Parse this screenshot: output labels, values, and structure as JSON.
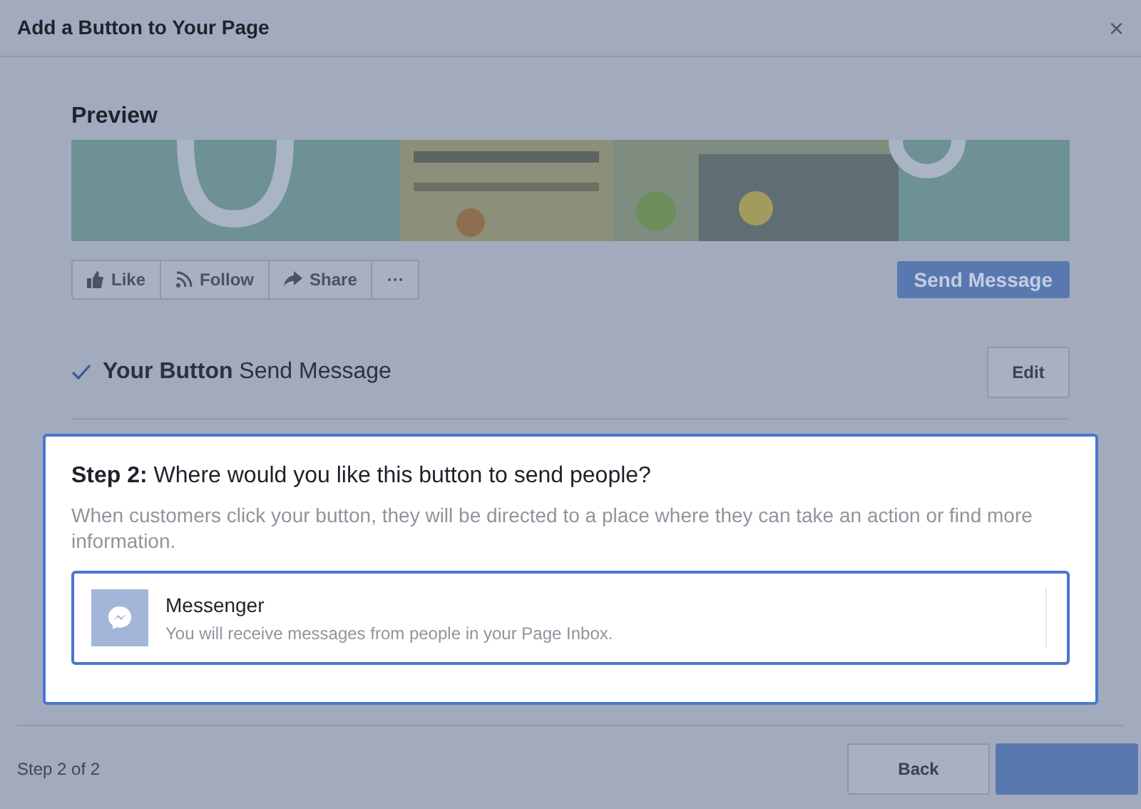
{
  "dialog": {
    "title": "Add a Button to Your Page",
    "close": "×"
  },
  "preview": {
    "heading": "Preview",
    "actions": [
      {
        "label": "Like",
        "kind": "like"
      },
      {
        "label": "Follow",
        "kind": "follow"
      },
      {
        "label": "Share",
        "kind": "share"
      },
      {
        "label": "···",
        "kind": "more"
      }
    ],
    "primary_button": "Send Message"
  },
  "your_button": {
    "checked": true,
    "label": "Your Button",
    "value": "Send Message",
    "edit_button": "Edit"
  },
  "step": {
    "question": "**Step 2:** Where would you like this button to send people?",
    "description": "When customers click your button, they will be directed to a place where they can take an action or find more information.",
    "options": [
      {
        "title": "Messenger",
        "description": "You will receive messages from people in your Page Inbox.",
        "selected": true
      }
    ]
  },
  "footer": {
    "progress": "Step 2 of 2",
    "buttons": [
      {
        "label": "Back",
        "kind": "secondary"
      },
      {
        "kind": "primary"
      }
    ]
  }
}
